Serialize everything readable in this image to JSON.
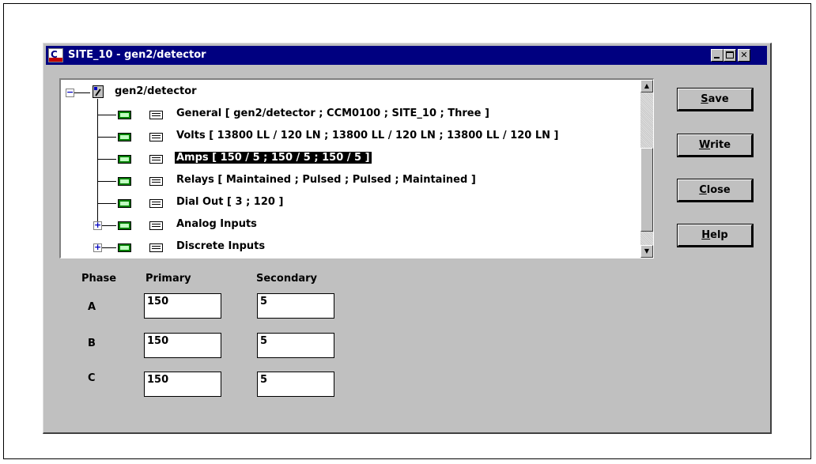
{
  "window": {
    "title": "SITE_10 - gen2/detector"
  },
  "tree": {
    "root": "gen2/detector",
    "items": [
      {
        "label": "General  [ gen2/detector ; CCM0100 ; SITE_10 ; Three ]"
      },
      {
        "label": "Volts  [ 13800 LL / 120 LN ; 13800 LL / 120 LN ; 13800 LL / 120 LN ]"
      },
      {
        "label": "Amps  [ 150 / 5 ; 150 / 5 ; 150 / 5 ]"
      },
      {
        "label": "Relays  [ Maintained ; Pulsed ; Pulsed ; Maintained ]"
      },
      {
        "label": "Dial Out  [ 3 ; 120 ]"
      },
      {
        "label": "Analog Inputs"
      },
      {
        "label": "Discrete Inputs"
      }
    ]
  },
  "buttons": {
    "save": {
      "key": "S",
      "rest": "ave"
    },
    "write": {
      "key": "W",
      "rest": "rite"
    },
    "close": {
      "key": "C",
      "rest": "lose"
    },
    "help": {
      "key": "H",
      "rest": "elp"
    }
  },
  "table": {
    "phase_header": "Phase",
    "primary_header": "Primary",
    "secondary_header": "Secondary",
    "rows": [
      {
        "phase": "A",
        "primary": "150",
        "secondary": "5"
      },
      {
        "phase": "B",
        "primary": "150",
        "secondary": "5"
      },
      {
        "phase": "C",
        "primary": "150",
        "secondary": "5"
      }
    ]
  },
  "icons": {
    "app": "onan-app-icon",
    "scroll_up": "scroll-up-arrow",
    "scroll_down": "scroll-down-arrow"
  },
  "colors": {
    "titlebar": "#000080",
    "face": "#c0c0c0",
    "selection": "#000000"
  }
}
